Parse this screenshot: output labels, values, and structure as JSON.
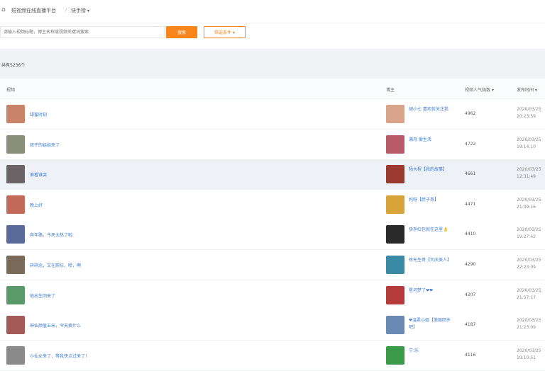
{
  "topbar": {
    "home_icon": "home-icon",
    "title": "短视频在线直播平台",
    "separator": "/",
    "selector": "快手榜",
    "chevron": "▾"
  },
  "search": {
    "placeholder": "请输入视频标题，博主名称或视频关键词搜索",
    "button_label": "搜索",
    "filter_label": "筛选条件",
    "filter_chevron": "▾"
  },
  "summary": {
    "count_text": "共有5236个"
  },
  "table": {
    "columns": [
      "视频",
      "博主",
      "视频人气指数 ▾",
      "发布时间 ▾"
    ],
    "rows": [
      {
        "title": "甜蜜时刻",
        "author": "胡小七 喜欢就关注我",
        "popularity": "4962",
        "time": "2020/03/25\n20:23:59",
        "thumb_color": "#c9836a",
        "avatar_color": "#d9a48a"
      },
      {
        "title": "孩子的姐姐来了",
        "author": "满月 爱生活",
        "popularity": "4722",
        "time": "2020/03/25\n19:14:10",
        "thumb_color": "#8a8f7a",
        "avatar_color": "#b85a6a"
      },
      {
        "title": "谁看谁哭",
        "author": "杨大程【我的故事】",
        "popularity": "4661",
        "time": "2020/03/25\n12:31:49",
        "thumb_color": "#6b6466",
        "avatar_color": "#9a3a2e"
      },
      {
        "title": "晚上好",
        "author": "妈呀【胖子哥】",
        "popularity": "4471",
        "time": "2020/03/25\n21:09:16",
        "thumb_color": "#c26a5a",
        "avatar_color": "#d8a43a"
      },
      {
        "title": "奔年路，今天太热了啦",
        "author": "快手红包就在这里👌",
        "popularity": "4410",
        "time": "2020/03/25\n19:27:42",
        "thumb_color": "#5a6a9a",
        "avatar_color": "#2a2a2a"
      },
      {
        "title": "碎碎念，又在爬坑，哈，啊",
        "author": "徐先生哥【大庆美人】",
        "popularity": "4290",
        "time": "2020/03/25\n22:23:09",
        "thumb_color": "#7a6a5a",
        "avatar_color": "#3a8aa5"
      },
      {
        "title": "他出生回来了",
        "author": "星河梦了❤❤",
        "popularity": "4207",
        "time": "2020/03/25\n21:57:17",
        "thumb_color": "#5a9a6a",
        "avatar_color": "#b53a3a"
      },
      {
        "title": "神仙颜值五米，今天换什么",
        "author": "❤温柔小姐【美丽回乡吧】",
        "popularity": "4187",
        "time": "2020/03/25\n21:23:09",
        "thumb_color": "#a55a5a",
        "avatar_color": "#6a8ab5"
      },
      {
        "title": "小仙女来了，等我快点过来了！",
        "author": "宁.乐",
        "popularity": "4116",
        "time": "2020/03/25\n19:10:51",
        "thumb_color": "#8a8a8a",
        "avatar_color": "#3a9a4a"
      }
    ]
  }
}
